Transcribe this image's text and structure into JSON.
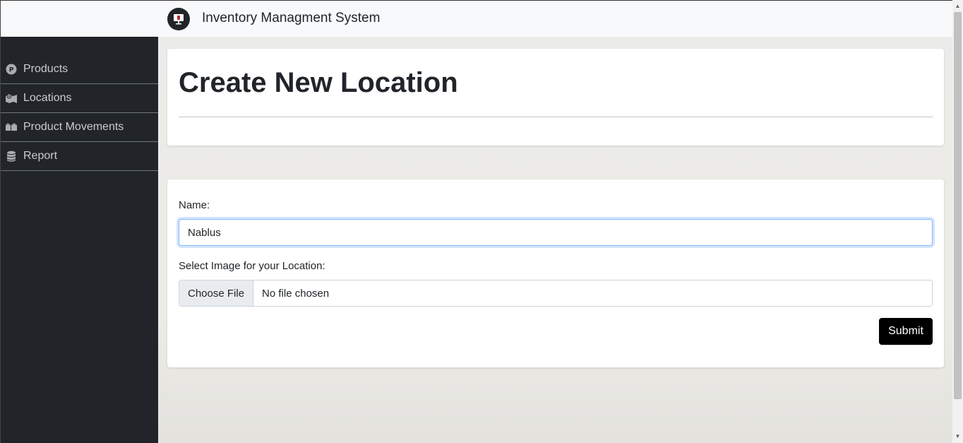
{
  "app": {
    "title": "Inventory Managment System",
    "logo_icon": "monitor-icon"
  },
  "sidebar": {
    "items": [
      {
        "label": "Products",
        "icon": "product-p-circle-icon"
      },
      {
        "label": "Locations",
        "icon": "map-location-icon"
      },
      {
        "label": "Product Movements",
        "icon": "boxes-icon"
      },
      {
        "label": "Report",
        "icon": "database-icon"
      }
    ]
  },
  "page": {
    "title": "Create New Location"
  },
  "form": {
    "name_label": "Name:",
    "name_value": "Nablus",
    "image_label": "Select Image for your Location:",
    "file_button": "Choose File",
    "file_status": "No file chosen",
    "submit_label": "Submit"
  },
  "colors": {
    "sidebar_bg": "#212529",
    "navbar_bg": "#f8f9fa",
    "submit_bg": "#000000",
    "focus_border": "#86b7fe"
  }
}
